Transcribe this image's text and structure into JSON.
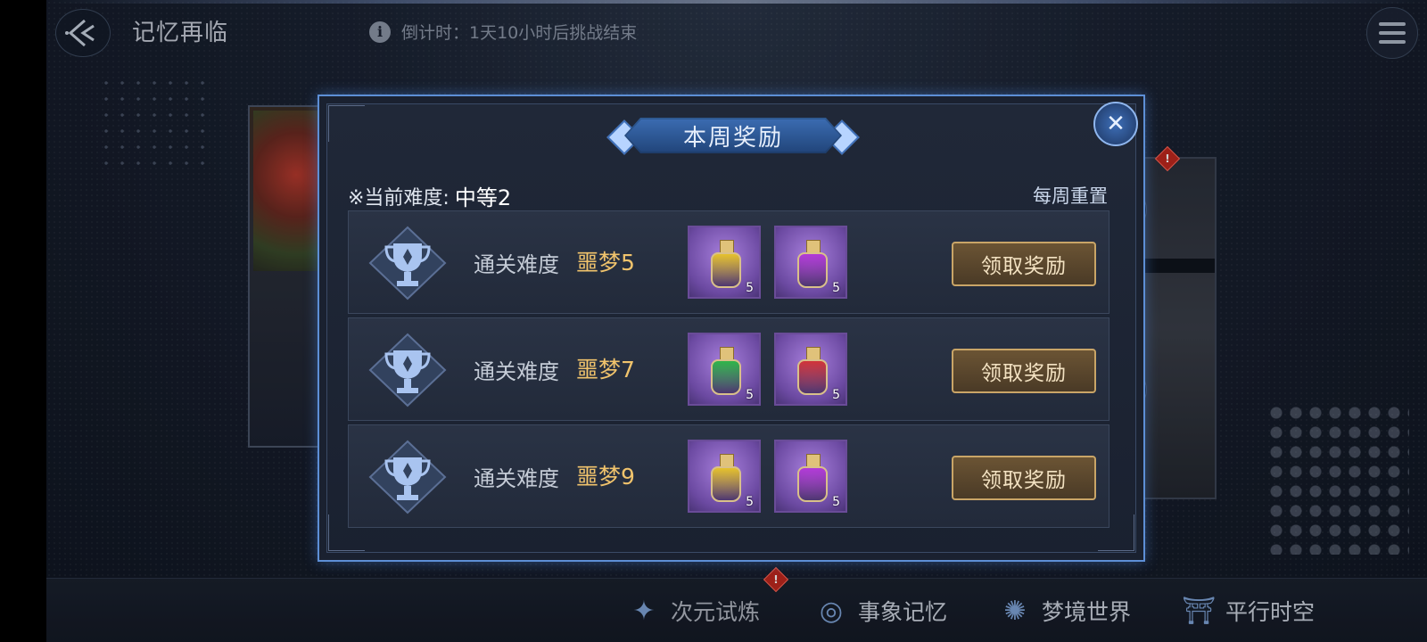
{
  "header": {
    "back_icon": "back-arrow-icon",
    "title": "记忆再临",
    "countdown": "倒计时：1天10小时后挑战结束",
    "info_icon": "i",
    "menu_icon": "hamburger-menu-icon"
  },
  "modal": {
    "title": "本周奖励",
    "close_glyph": "✕",
    "difficulty_prefix": "※当前难度:",
    "difficulty_value": "中等2",
    "weekly_reset": "每周重置",
    "rows": [
      {
        "label": "通关难度",
        "level": "噩梦5",
        "items": [
          {
            "color": "#e5c12c",
            "count": "5"
          },
          {
            "color": "#b23ad8",
            "count": "5"
          }
        ],
        "button": "领取奖励"
      },
      {
        "label": "通关难度",
        "level": "噩梦7",
        "items": [
          {
            "color": "#2fb44a",
            "count": "5"
          },
          {
            "color": "#d0343a",
            "count": "5"
          }
        ],
        "button": "领取奖励"
      },
      {
        "label": "通关难度",
        "level": "噩梦9",
        "items": [
          {
            "color": "#e5c12c",
            "count": "5"
          },
          {
            "color": "#b23ad8",
            "count": "5"
          }
        ],
        "button": "领取奖励"
      }
    ]
  },
  "bottom_nav": [
    {
      "label": "次元试炼",
      "icon": "✦",
      "active": true
    },
    {
      "label": "事象记忆",
      "icon": "◎",
      "active": false
    },
    {
      "label": "梦境世界",
      "icon": "✺",
      "active": false
    },
    {
      "label": "平行时空",
      "icon": "⛩",
      "active": false
    }
  ],
  "colors": {
    "accent_blue": "#5d8fd6",
    "gold": "#f0c36c",
    "alert_red": "#c0281e"
  }
}
